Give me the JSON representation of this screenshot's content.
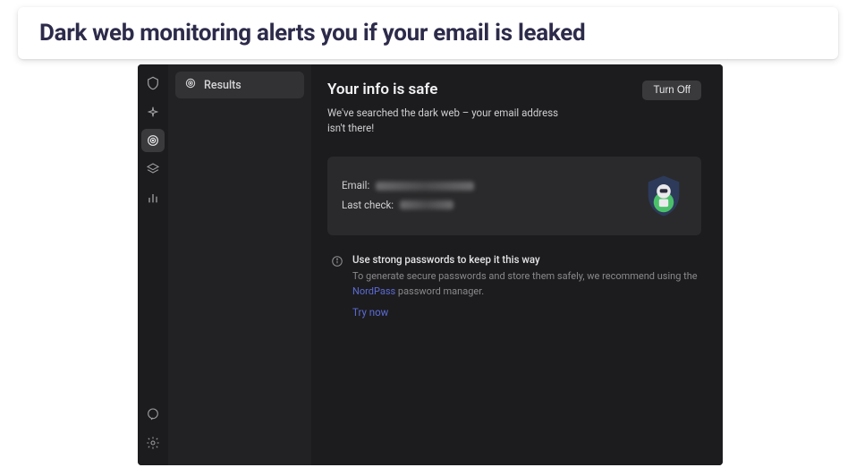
{
  "caption": "Dark web monitoring alerts you if your email is leaked",
  "sidebar": {
    "heading": "Results"
  },
  "main": {
    "title": "Your info is safe",
    "turn_off_label": "Turn Off",
    "subcopy": "We've searched the dark web – your email address isn't there!",
    "card": {
      "email_label": "Email:",
      "last_check_label": "Last check:"
    },
    "tip": {
      "title": "Use strong passwords to keep it this way",
      "desc_pre": "To generate secure passwords and store them safely, we recommend using the ",
      "link_label": "NordPass",
      "desc_post": " password manager.",
      "try_now": "Try now"
    }
  }
}
